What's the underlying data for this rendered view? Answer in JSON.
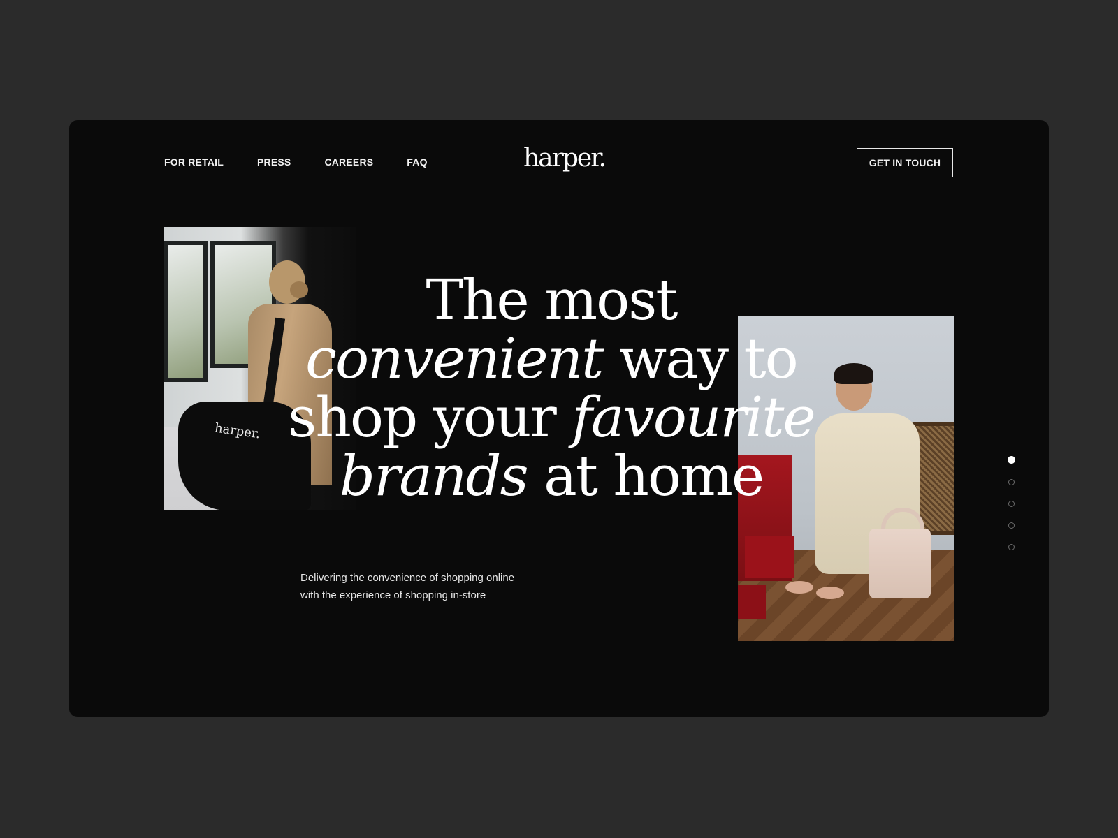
{
  "nav": {
    "items": [
      {
        "label": "FOR RETAIL"
      },
      {
        "label": "PRESS"
      },
      {
        "label": "CAREERS"
      },
      {
        "label": "FAQ"
      }
    ]
  },
  "brand": {
    "logo": "harper."
  },
  "header": {
    "cta_label": "GET IN TOUCH"
  },
  "hero": {
    "line1": "The most",
    "line2_em": "convenient",
    "line2_rest": " way to",
    "line3_start": "shop your ",
    "line3_em": "favourite",
    "line4_em": "brands",
    "line4_rest": " at home",
    "subtitle_line1": "Delivering the convenience of shopping online",
    "subtitle_line2": "with the experience of shopping in-store"
  },
  "images": {
    "photo1_bag_text": "harper.",
    "photo1_alt": "Woman carrying harper tote bag",
    "photo2_alt": "Woman trying on shoes at home"
  },
  "pager": {
    "count": 5,
    "active_index": 0
  },
  "colors": {
    "background": "#2b2b2b",
    "panel": "#0a0a0a",
    "text": "#ffffff",
    "accent_red": "#9b121a"
  }
}
